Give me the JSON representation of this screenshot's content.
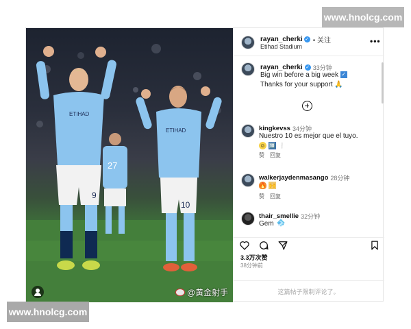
{
  "watermark": {
    "top": "www.hnolcg.com",
    "bottom": "www.hnolcg.com"
  },
  "photo": {
    "weibo_credit": "@黄金射手",
    "player_left_number": "9",
    "player_right_number": "10",
    "player_bg_number": "27",
    "sponsor": "ETIHAD"
  },
  "header": {
    "username": "rayan_cherki",
    "verified": "✓",
    "follow": "• 关注",
    "location": "Etihad Stadium",
    "more": "•••"
  },
  "caption": {
    "username": "rayan_cherki",
    "time": "33分钟",
    "line1": "Big win before a big week",
    "check_emoji": "✓",
    "line2": "Thanks for your support 🙏"
  },
  "comments": [
    {
      "username": "kingkevss",
      "time": "34分钟",
      "text": "Nuestro 10 es mejor que el tuyo.",
      "emojis": [
        "☺",
        "🔟",
        "❕"
      ],
      "reply": "赞",
      "reply2": "回复"
    },
    {
      "username": "walkerjaydenmasango",
      "time": "28分钟",
      "text": "",
      "emojis": [
        "🔥",
        "🙌"
      ],
      "reply": "赞",
      "reply2": "回复"
    },
    {
      "username": "thair_smellie",
      "time": "32分钟",
      "text": "Gem",
      "emojis": [
        "💎"
      ]
    }
  ],
  "actions": {
    "likes": "3.3万次赞",
    "ago": "38分钟前",
    "comments_disabled": "这篇帖子限制评论了。"
  },
  "colors": {
    "verified": "#3897f0",
    "jersey": "#8cc4ee"
  }
}
